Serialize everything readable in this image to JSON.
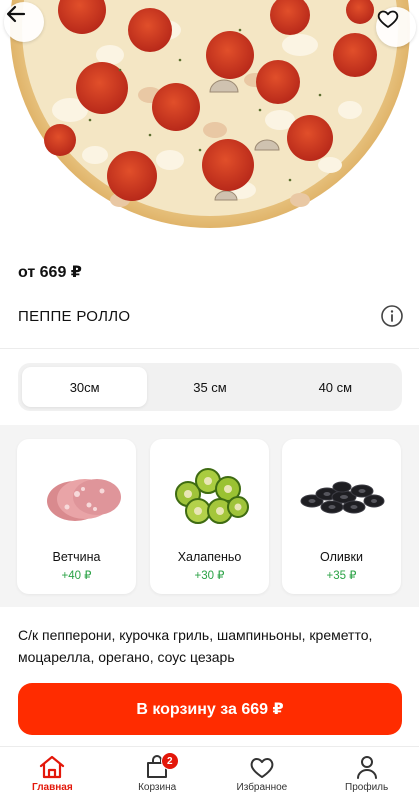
{
  "product": {
    "price_label": "от 669 ₽",
    "title": "ПЕППЕ РОЛЛО",
    "description": "С/к пепперони, курочка гриль, шампиньоны, креметто, моцарелла, орегано, соус цезарь"
  },
  "sizes": {
    "options": [
      "30см",
      "35 см",
      "40 см"
    ],
    "selected": "30см"
  },
  "toppings": [
    {
      "name": "Ветчина",
      "price": "+40 ₽",
      "icon": "ham-icon"
    },
    {
      "name": "Халапеньо",
      "price": "+30 ₽",
      "icon": "jalapeno-icon"
    },
    {
      "name": "Оливки",
      "price": "+35 ₽",
      "icon": "olives-icon"
    }
  ],
  "cart_button": {
    "label": "В корзину за 669 ₽"
  },
  "nav": {
    "items": [
      {
        "label": "Главная",
        "icon": "home-icon",
        "active": true
      },
      {
        "label": "Корзина",
        "icon": "cart-icon",
        "badge": "2"
      },
      {
        "label": "Избранное",
        "icon": "heart-icon"
      },
      {
        "label": "Профиль",
        "icon": "profile-icon"
      }
    ]
  },
  "colors": {
    "accent": "#ff2c00",
    "nav_active": "#e3170a",
    "topping_price": "#2aa245"
  }
}
